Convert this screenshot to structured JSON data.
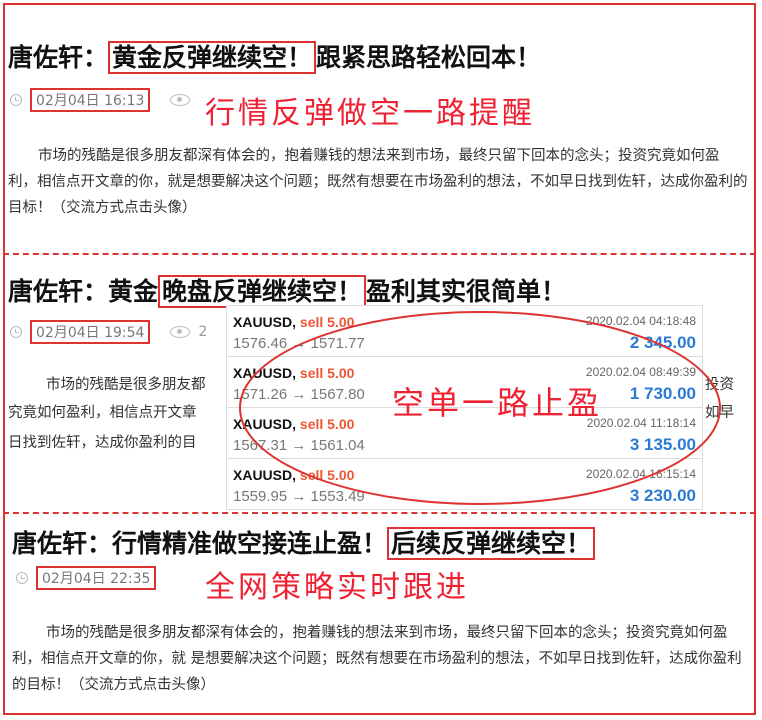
{
  "posts": [
    {
      "title_pre": "唐佐轩：",
      "title_box": "黄金反弹继续空！",
      "title_post": "跟紧思路轻松回本！",
      "date": "02月04日 16:13",
      "views": "",
      "annotation": "行情反弹做空一路提醒",
      "paragraph": "市场的残酷是很多朋友都深有体会的，抱着赚钱的想法来到市场，最终只留下回本的念头；投资究竟如何盈利，相信点开文章的你，就是想要解决这个问题；既然有想要在市场盈利的想法，不如早日找到佐轩，达成你盈利的目标！（交流方式点击头像）"
    },
    {
      "title_pre": "唐佐轩：黄金",
      "title_box": "晚盘反弹继续空！",
      "title_post": "盈利其实很简单！",
      "date": "02月04日 19:54",
      "views": "2",
      "annotation": "空单一路止盈",
      "para_lines": [
        "市场的残酷是很多朋友都",
        "究竟如何盈利，相信点开文章",
        "日找到佐轩，达成你盈利的目"
      ],
      "para_tails": [
        "投资",
        "如早",
        ""
      ]
    },
    {
      "title_pre": "唐佐轩：行情精准做空接连止盈！",
      "title_box": "后续反弹继续空！",
      "title_post": "",
      "date": "02月04日 22:35",
      "annotation": "全网策略实时跟进",
      "paragraph": "市场的残酷是很多朋友都深有体会的，抱着赚钱的想法来到市场，最终只留下回本的念头；投资究竟如何盈利，相信点开文章的你，就 是想要解决这个问题；既然有想要在市场盈利的想法，不如早日找到佐轩，达成你盈利的目标！（交流方式点击头像）"
    }
  ],
  "trades": [
    {
      "symbol": "XAUUSD,",
      "side": "sell 5.00",
      "time": "2020.02.04 04:18:48",
      "prices": "1576.46 → 1571.77",
      "profit": "2 345.00"
    },
    {
      "symbol": "XAUUSD,",
      "side": "sell 5.00",
      "time": "2020.02.04 08:49:39",
      "prices": "1571.26 → 1567.80",
      "profit": "1 730.00"
    },
    {
      "symbol": "XAUUSD,",
      "side": "sell 5.00",
      "time": "2020.02.04 11:18:14",
      "prices": "1567.31 → 1561.04",
      "profit": "3 135.00"
    },
    {
      "symbol": "XAUUSD,",
      "side": "sell 5.00",
      "time": "2020.02.04 16:15:14",
      "prices": "1559.95 → 1553.49",
      "profit": "3 230.00"
    }
  ],
  "colors": {
    "accent_red": "#dd3333",
    "profit_blue": "#2a7ad6"
  }
}
